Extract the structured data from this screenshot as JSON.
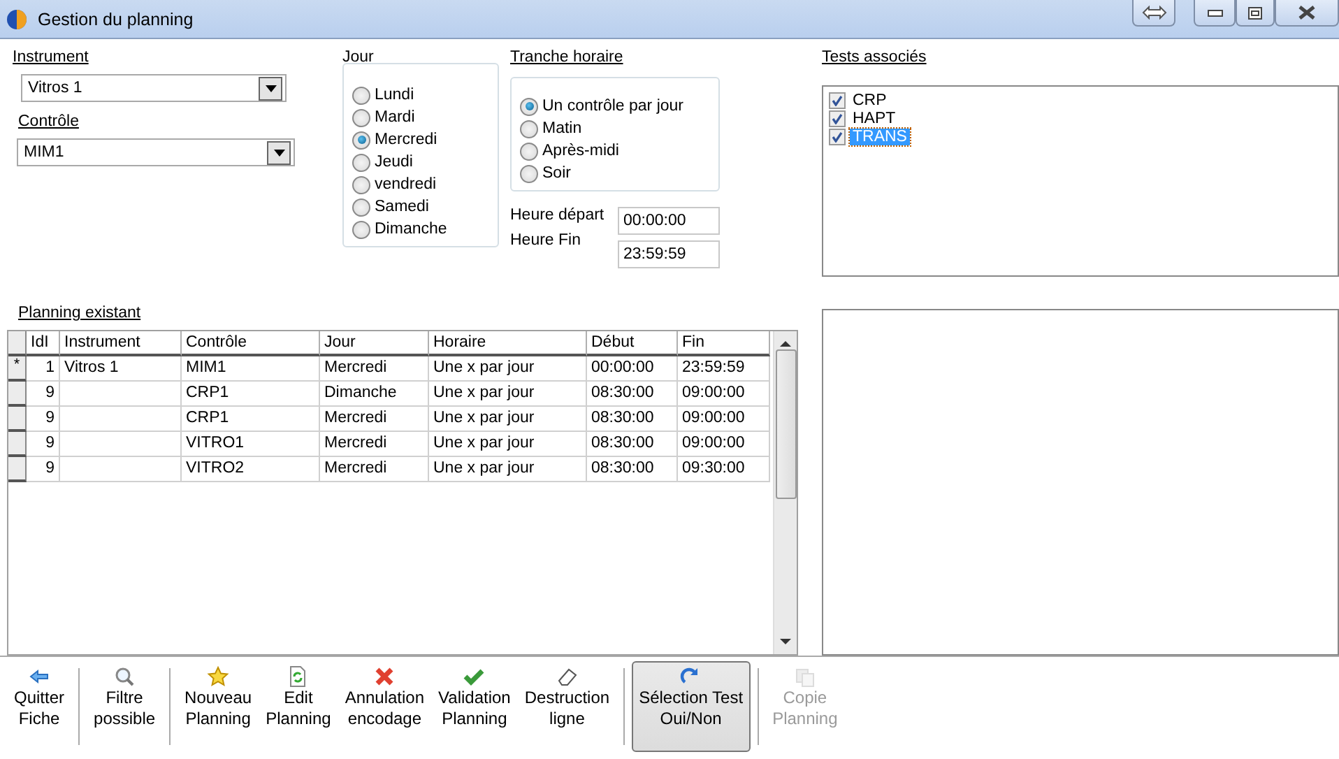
{
  "window": {
    "title": "Gestion du planning"
  },
  "instrument": {
    "label": "Instrument",
    "value": "Vitros 1"
  },
  "controle": {
    "label": "Contrôle",
    "value": "MIM1"
  },
  "jour": {
    "label": "Jour",
    "options": [
      {
        "label": "Lundi",
        "selected": false
      },
      {
        "label": "Mardi",
        "selected": false
      },
      {
        "label": "Mercredi",
        "selected": true
      },
      {
        "label": "Jeudi",
        "selected": false
      },
      {
        "label": "vendredi",
        "selected": false
      },
      {
        "label": "Samedi",
        "selected": false
      },
      {
        "label": "Dimanche",
        "selected": false
      }
    ]
  },
  "tranche_horaire": {
    "label": "Tranche horaire",
    "options": [
      {
        "label": "Un contrôle par jour",
        "selected": true
      },
      {
        "label": "Matin",
        "selected": false
      },
      {
        "label": "Après-midi",
        "selected": false
      },
      {
        "label": "Soir",
        "selected": false
      }
    ]
  },
  "heure_depart": {
    "label": "Heure départ",
    "value": "00:00:00"
  },
  "heure_fin": {
    "label": "Heure Fin",
    "value": "23:59:59"
  },
  "tests": {
    "label": "Tests associés",
    "items": [
      {
        "label": "CRP",
        "checked": true,
        "selected": false
      },
      {
        "label": "HAPT",
        "checked": true,
        "selected": false
      },
      {
        "label": "TRANS",
        "checked": true,
        "selected": true
      }
    ]
  },
  "planning": {
    "label": "Planning existant",
    "columns": [
      "IdI",
      "Instrument",
      "Contrôle",
      "Jour",
      "Horaire",
      "Début",
      "Fin"
    ],
    "rows": [
      {
        "marker": "*",
        "cells": [
          "1",
          "Vitros 1",
          "MIM1",
          "Mercredi",
          "Une x par jour",
          "00:00:00",
          "23:59:59"
        ]
      },
      {
        "cells": [
          "9",
          "",
          "CRP1",
          "Dimanche",
          "Une x par jour",
          "08:30:00",
          "09:00:00"
        ]
      },
      {
        "cells": [
          "9",
          "",
          "CRP1",
          "Mercredi",
          "Une x par jour",
          "08:30:00",
          "09:00:00"
        ]
      },
      {
        "cells": [
          "9",
          "",
          "VITRO1",
          "Mercredi",
          "Une x par jour",
          "08:30:00",
          "09:00:00"
        ]
      },
      {
        "cells": [
          "9",
          "",
          "VITRO2",
          "Mercredi",
          "Une x par jour",
          "08:30:00",
          "09:30:00"
        ]
      }
    ]
  },
  "toolbar": [
    {
      "kind": "arrow",
      "lines": [
        "Quitter",
        "Fiche"
      ],
      "pressed": false,
      "disabled": false
    },
    {
      "kind": "separator"
    },
    {
      "kind": "search",
      "lines": [
        "Filtre",
        "possible"
      ],
      "pressed": false,
      "disabled": false
    },
    {
      "kind": "separator"
    },
    {
      "kind": "star",
      "lines": [
        "Nouveau",
        "Planning"
      ],
      "pressed": false,
      "disabled": false
    },
    {
      "kind": "edit",
      "lines": [
        "Edit",
        "Planning"
      ],
      "pressed": false,
      "disabled": false
    },
    {
      "kind": "cancel",
      "lines": [
        "Annulation",
        "encodage"
      ],
      "pressed": false,
      "disabled": false
    },
    {
      "kind": "check",
      "lines": [
        "Validation",
        "Planning"
      ],
      "pressed": false,
      "disabled": false
    },
    {
      "kind": "eraser",
      "lines": [
        "Destruction",
        "ligne"
      ],
      "pressed": false,
      "disabled": false
    },
    {
      "kind": "separator"
    },
    {
      "kind": "redo",
      "lines": [
        "Sélection Test",
        "Oui/Non"
      ],
      "pressed": true,
      "disabled": false
    },
    {
      "kind": "separator"
    },
    {
      "kind": "copy",
      "lines": [
        "Copie",
        "Planning"
      ],
      "pressed": false,
      "disabled": true
    }
  ]
}
